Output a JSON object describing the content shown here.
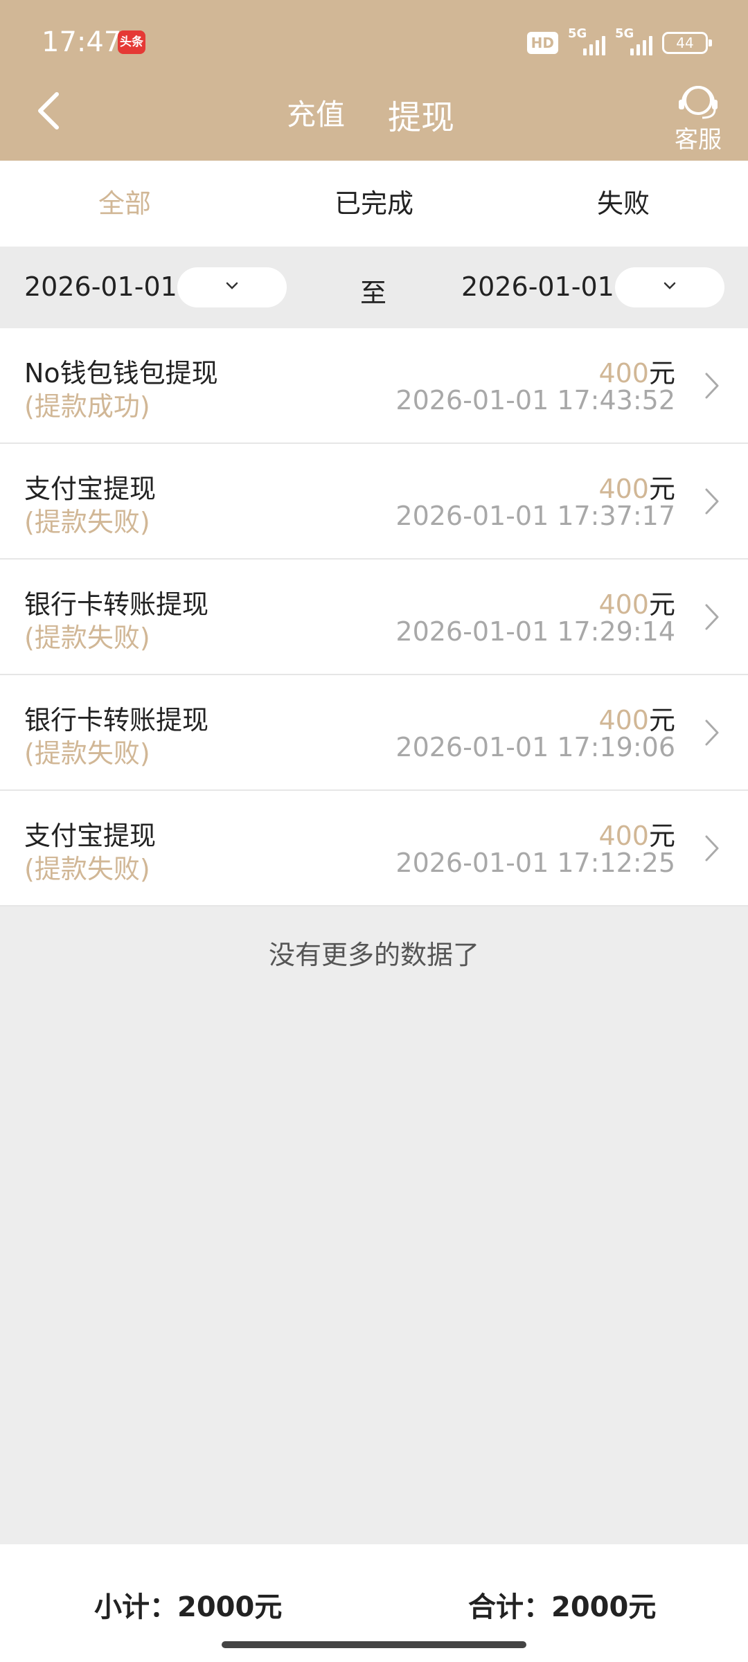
{
  "status_bar": {
    "time": "17:47",
    "app_badge": "头条",
    "hd": "HD",
    "network1": "5G",
    "network2": "5G",
    "battery": "44"
  },
  "header": {
    "back_icon": "chevron-left-icon",
    "tab_recharge": "充值",
    "tab_withdraw": "提现",
    "customer_service_label": "客服",
    "customer_service_icon": "headset-icon",
    "color": "#d1b796"
  },
  "filter_tabs": [
    {
      "label": "全部",
      "active": true
    },
    {
      "label": "已完成",
      "active": false
    },
    {
      "label": "失败",
      "active": false
    }
  ],
  "date_range": {
    "start": "2026-01-01",
    "separator": "至",
    "end": "2026-01-01"
  },
  "records": [
    {
      "title": "No钱包钱包提现",
      "status": "(提款成功)",
      "amount": "400",
      "unit": "元",
      "time": "2026-01-01 17:43:52"
    },
    {
      "title": "支付宝提现",
      "status": "(提款失败)",
      "amount": "400",
      "unit": "元",
      "time": "2026-01-01 17:37:17"
    },
    {
      "title": "银行卡转账提现",
      "status": "(提款失败)",
      "amount": "400",
      "unit": "元",
      "time": "2026-01-01 17:29:14"
    },
    {
      "title": "银行卡转账提现",
      "status": "(提款失败)",
      "amount": "400",
      "unit": "元",
      "time": "2026-01-01 17:19:06"
    },
    {
      "title": "支付宝提现",
      "status": "(提款失败)",
      "amount": "400",
      "unit": "元",
      "time": "2026-01-01 17:12:25"
    }
  ],
  "no_more_text": "没有更多的数据了",
  "footer": {
    "subtotal": "小计：2000元",
    "total": "合计：2000元"
  }
}
